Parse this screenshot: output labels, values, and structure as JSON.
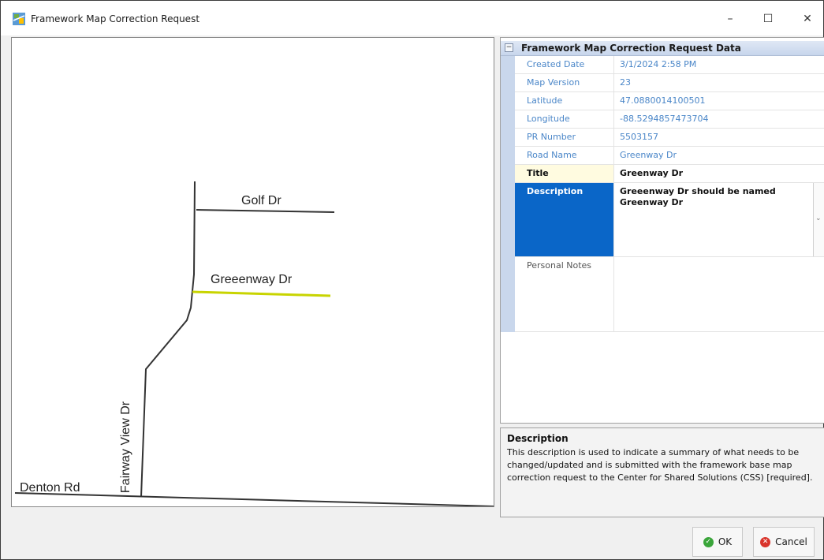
{
  "window": {
    "title": "Framework Map Correction Request",
    "min_glyph": "–",
    "max_glyph": "☐",
    "close_glyph": "✕"
  },
  "map": {
    "roads": {
      "golf": "Golf Dr",
      "greeenway": "Greeenway Dr",
      "fairway": "Fairway View Dr",
      "denton": "Denton Rd"
    },
    "highlight_color": "#c8d400"
  },
  "grid": {
    "header": "Framework Map Correction Request Data",
    "collapse_glyph": "−",
    "rows": [
      {
        "label": "Created Date",
        "value": "3/1/2024 2:58 PM"
      },
      {
        "label": "Map Version",
        "value": "23"
      },
      {
        "label": "Latitude",
        "value": "47.0880014100501"
      },
      {
        "label": "Longitude",
        "value": "-88.5294857473704"
      },
      {
        "label": "PR Number",
        "value": "5503157"
      },
      {
        "label": "Road Name",
        "value": "Greenway Dr"
      }
    ],
    "title_row": {
      "label": "Title",
      "value": "Greenway Dr"
    },
    "description_row": {
      "label": "Description",
      "value": "Greeenway Dr should be named Greenway Dr"
    },
    "notes_row": {
      "label": "Personal Notes",
      "value": ""
    },
    "colors": {
      "selected": "#0a66c8",
      "gutter": "#c9d7ec",
      "readonly_text": "#4a86c8"
    }
  },
  "help": {
    "title": "Description",
    "text": "This description is used to indicate a summary of what needs to be changed/updated and is submitted with the framework base map correction request to the Center for Shared Solutions (CSS) [required]."
  },
  "buttons": {
    "ok": "OK",
    "cancel": "Cancel",
    "ok_color": "#3aa53a",
    "cancel_color": "#d9342b"
  }
}
